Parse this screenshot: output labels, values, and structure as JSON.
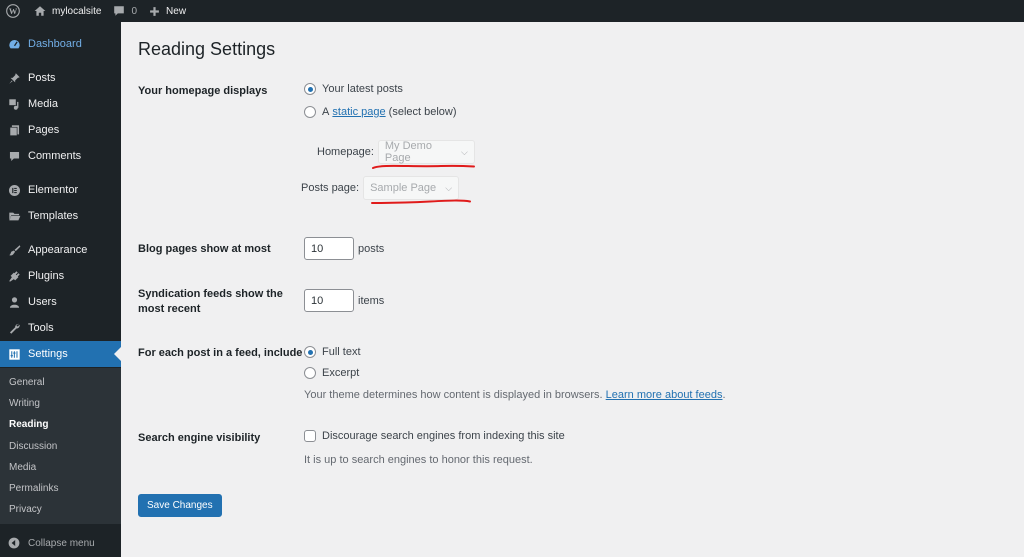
{
  "adminbar": {
    "wp_logo": "wordpress-logo-icon",
    "site_name": "mylocalsite",
    "comments_count": "0",
    "new_label": "New"
  },
  "sidebar": {
    "items": [
      {
        "label": "Dashboard",
        "icon": "dashboard-icon"
      },
      {
        "label": "Posts",
        "icon": "pin-icon"
      },
      {
        "label": "Media",
        "icon": "media-icon"
      },
      {
        "label": "Pages",
        "icon": "pages-icon"
      },
      {
        "label": "Comments",
        "icon": "comment-icon"
      },
      {
        "label": "Elementor",
        "icon": "elementor-icon"
      },
      {
        "label": "Templates",
        "icon": "folder-icon"
      },
      {
        "label": "Appearance",
        "icon": "paintbrush-icon"
      },
      {
        "label": "Plugins",
        "icon": "plugin-icon"
      },
      {
        "label": "Users",
        "icon": "user-icon"
      },
      {
        "label": "Tools",
        "icon": "wrench-icon"
      },
      {
        "label": "Settings",
        "icon": "settings-icon"
      }
    ],
    "submenu": [
      "General",
      "Writing",
      "Reading",
      "Discussion",
      "Media",
      "Permalinks",
      "Privacy"
    ],
    "current_submenu": "Reading",
    "collapse_label": "Collapse menu"
  },
  "page": {
    "title": "Reading Settings",
    "homepage_displays": {
      "label": "Your homepage displays",
      "option_latest": "Your latest posts",
      "option_static_prefix": "A",
      "option_static_link": "static page",
      "option_static_suffix": "(select below)",
      "selected": "latest",
      "homepage_label": "Homepage:",
      "homepage_value": "My Demo Page",
      "posts_page_label": "Posts page:",
      "posts_page_value": "Sample Page"
    },
    "blog_pages": {
      "label": "Blog pages show at most",
      "value": "10",
      "unit": "posts"
    },
    "syndication": {
      "label": "Syndication feeds show the most recent",
      "value": "10",
      "unit": "items"
    },
    "feed_include": {
      "label": "For each post in a feed, include",
      "option_full": "Full text",
      "option_excerpt": "Excerpt",
      "selected": "full",
      "description": "Your theme determines how content is displayed in browsers.",
      "link": "Learn more about feeds",
      "link_suffix": "."
    },
    "search_visibility": {
      "label": "Search engine visibility",
      "checkbox_label": "Discourage search engines from indexing this site",
      "checked": false,
      "description": "It is up to search engines to honor this request."
    },
    "save_label": "Save Changes"
  },
  "colors": {
    "accent": "#2271b1",
    "sidebar_bg": "#1d2327",
    "submenu_bg": "#2c3338",
    "annotation_red": "#e01b1b"
  }
}
